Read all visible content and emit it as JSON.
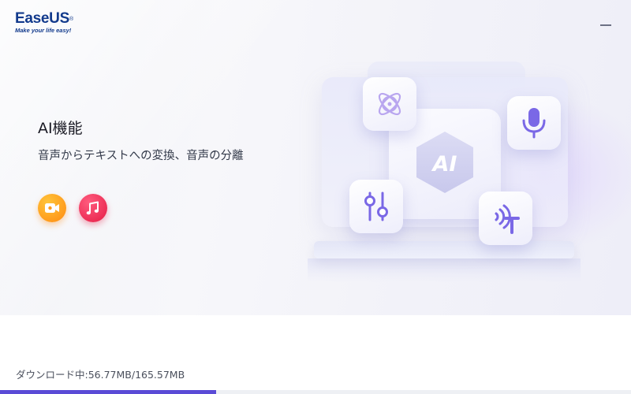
{
  "header": {
    "logo_text": "EaseUS",
    "logo_registered": "®",
    "logo_tagline": "Make your life easy!"
  },
  "feature": {
    "title": "AI機能",
    "subtitle": "音声からテキストへの変換、音声の分離",
    "apps": [
      {
        "name": "video-recorder",
        "icon": "video-camera-icon",
        "color": "#ff9a1a"
      },
      {
        "name": "music",
        "icon": "music-note-icon",
        "color": "#f0284f"
      }
    ],
    "illustration": {
      "center_label": "AI",
      "tiles": [
        "atom-icon",
        "microphone-icon",
        "equalizer-icon",
        "text-to-speech-icon"
      ],
      "accent": "#7a68e6"
    }
  },
  "download": {
    "status_text": "ダウンロード中:56.77MB/165.57MB",
    "downloaded_mb": 56.77,
    "total_mb": 165.57,
    "bar_color": "#5a4bd6"
  }
}
